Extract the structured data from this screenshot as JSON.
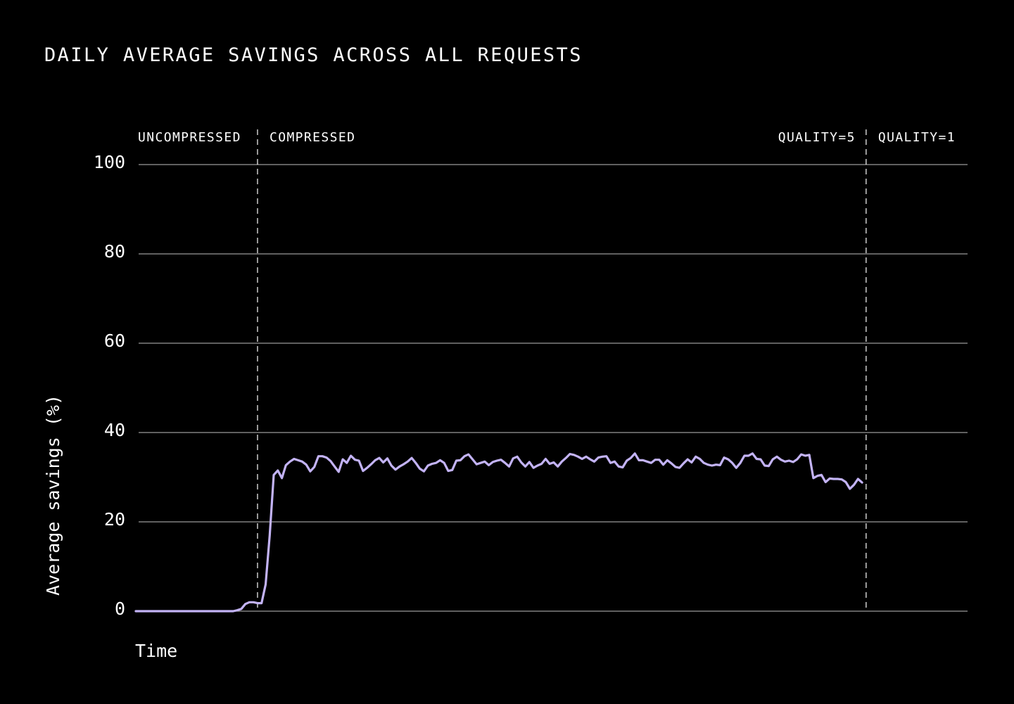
{
  "chart_data": {
    "type": "line",
    "title": "DAILY AVERAGE SAVINGS ACROSS ALL REQUESTS",
    "xlabel": "Time",
    "ylabel": "Average savings (%)",
    "ylim": [
      0,
      100
    ],
    "yticks": [
      0,
      20,
      40,
      60,
      80,
      100
    ],
    "grid": true,
    "colors": {
      "background": "#000000",
      "line": "#c3b3f5",
      "grid": "#9a9a9a",
      "text": "#ffffff"
    },
    "regions": [
      {
        "label": "UNCOMPRESSED",
        "start": 0,
        "end": 30
      },
      {
        "label": "COMPRESSED",
        "start": 30,
        "end": 180
      },
      {
        "label": "QUALITY=5",
        "start": 30,
        "end": 180
      },
      {
        "label": "QUALITY=1",
        "start": 180,
        "end": 205
      }
    ],
    "region_boundaries": [
      30,
      180
    ],
    "x_max": 205,
    "series": [
      {
        "values": [
          0,
          0,
          0,
          0,
          0,
          0,
          0,
          0,
          0,
          0,
          0,
          0,
          0,
          0,
          0,
          0,
          0,
          0,
          0,
          0,
          0,
          0,
          0,
          0,
          0,
          0.2,
          0.5,
          1.6,
          2.0,
          2.0,
          1.8,
          1.8,
          6.0,
          17.0,
          30.5,
          31.5,
          29.8,
          32.7,
          33.5,
          34.1,
          33.8,
          33.5,
          32.8,
          31.3,
          32.3,
          34.7,
          34.7,
          34.4,
          33.6,
          32.4,
          31.2,
          34.0,
          33.2,
          34.8,
          33.9,
          33.7,
          31.4,
          32.1,
          32.9,
          33.8,
          34.3,
          33.3,
          34.2,
          32.6,
          31.7,
          32.4,
          32.9,
          33.5,
          34.3,
          33.2,
          31.9,
          31.3,
          32.6,
          33.0,
          33.2,
          33.8,
          33.2,
          31.4,
          31.6,
          33.7,
          33.8,
          34.7,
          35.1,
          34.0,
          32.9,
          33.2,
          33.5,
          32.7,
          33.4,
          33.7,
          33.9,
          33.2,
          32.4,
          34.2,
          34.6,
          33.3,
          32.4,
          33.4,
          32.1,
          32.6,
          33.0,
          34.1,
          33.0,
          33.3,
          32.4,
          33.5,
          34.3,
          35.2,
          35.0,
          34.6,
          34.1,
          34.6,
          34.0,
          33.5,
          34.4,
          34.6,
          34.7,
          33.2,
          33.5,
          32.4,
          32.2,
          33.7,
          34.3,
          35.3,
          33.8,
          33.8,
          33.5,
          33.2,
          33.9,
          33.9,
          32.8,
          33.8,
          33.1,
          32.3,
          32.1,
          33.1,
          34.0,
          33.3,
          34.6,
          34.1,
          33.2,
          32.8,
          32.6,
          32.8,
          32.7,
          34.4,
          34.0,
          33.2,
          32.1,
          33.2,
          34.8,
          34.8,
          35.3,
          34.1,
          34.0,
          32.6,
          32.5,
          34.0,
          34.6,
          33.9,
          33.5,
          33.7,
          33.4,
          34.0,
          35.1,
          34.8,
          35.0,
          29.8,
          30.3,
          30.5,
          28.9,
          29.7,
          29.6,
          29.6,
          29.5,
          28.9,
          27.4,
          28.3,
          29.6,
          28.8
        ]
      }
    ]
  }
}
